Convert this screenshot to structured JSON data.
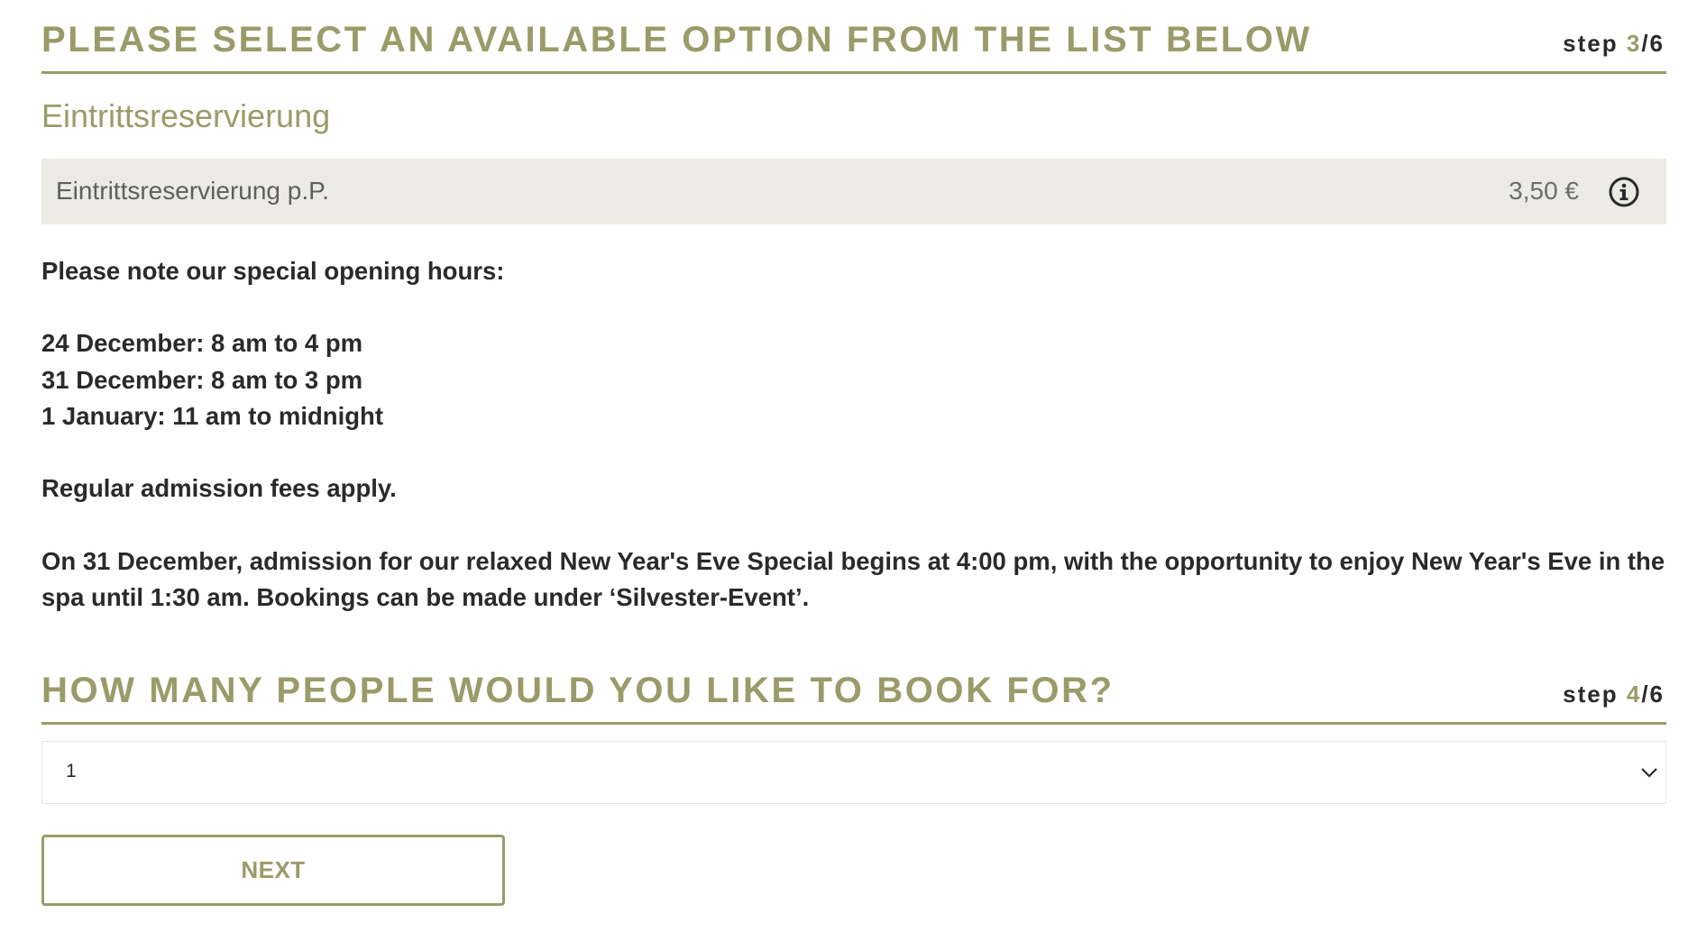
{
  "step3": {
    "title": "PLEASE SELECT AN AVAILABLE OPTION FROM THE LIST BELOW",
    "step_word": "step ",
    "step_current": "3",
    "step_total": "/6"
  },
  "group": {
    "title": "Eintrittsreservierung"
  },
  "option": {
    "name": "Eintrittsreservierung p.P.",
    "price": "3,50 €",
    "icon": "info-icon"
  },
  "notice": {
    "heading": "Please note our special opening hours:",
    "hours": [
      "24 December: 8 am to 4 pm",
      "31 December: 8 am to 3 pm",
      "1 January: 11 am to midnight"
    ],
    "fees": "Regular admission fees apply.",
    "special": "On 31 December, admission for our relaxed New Year's Eve Special begins at 4:00 pm, with the opportunity to enjoy New Year's Eve in the spa until 1:30 am. Bookings can be made under ‘Silvester-Event’."
  },
  "step4": {
    "title": "HOW MANY PEOPLE WOULD YOU LIKE TO BOOK FOR?",
    "step_word": "step ",
    "step_current": "4",
    "step_total": "/6"
  },
  "people_select": {
    "value": "1",
    "icon": "chevron-down-icon"
  },
  "next_button": {
    "label": "NEXT"
  },
  "colors": {
    "accent": "#9a9b69",
    "text": "#2a2a2a",
    "option_bg": "#ebebe3"
  }
}
